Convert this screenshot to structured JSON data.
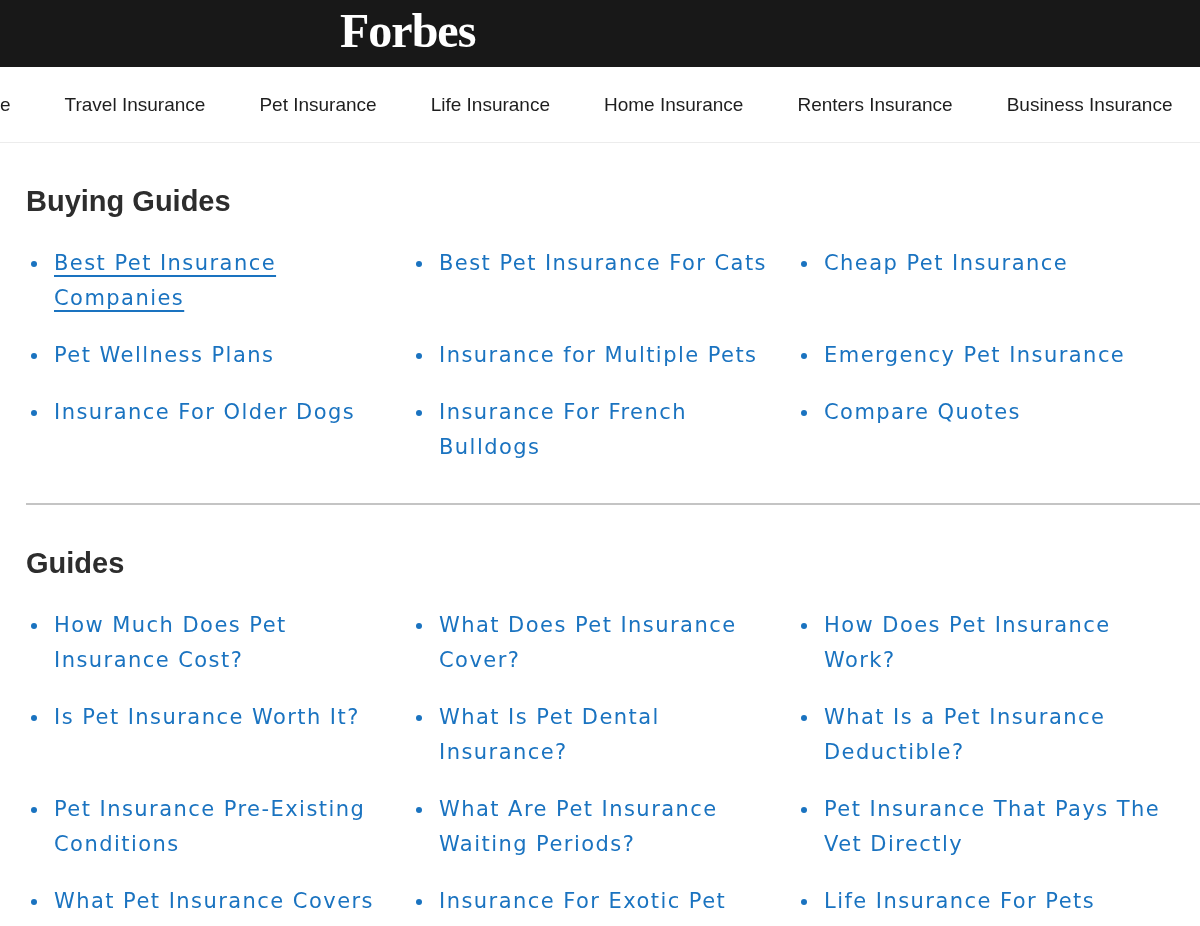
{
  "header": {
    "logo": "Forbes"
  },
  "nav": {
    "items": [
      {
        "label": "e"
      },
      {
        "label": "Travel Insurance"
      },
      {
        "label": "Pet Insurance"
      },
      {
        "label": "Life Insurance"
      },
      {
        "label": "Home Insurance"
      },
      {
        "label": "Renters Insurance"
      },
      {
        "label": "Business Insurance"
      }
    ]
  },
  "sections": [
    {
      "title": "Buying Guides",
      "links": [
        {
          "text": "Best Pet Insurance Companies",
          "hovered": true
        },
        {
          "text": "Best Pet Insurance For Cats",
          "hovered": false
        },
        {
          "text": "Cheap Pet Insurance",
          "hovered": false
        },
        {
          "text": "Pet Wellness Plans",
          "hovered": false
        },
        {
          "text": "Insurance for Multiple Pets",
          "hovered": false
        },
        {
          "text": "Emergency Pet Insurance",
          "hovered": false
        },
        {
          "text": "Insurance For Older Dogs",
          "hovered": false
        },
        {
          "text": "Insurance For French Bulldogs",
          "hovered": false
        },
        {
          "text": "Compare Quotes",
          "hovered": false
        }
      ]
    },
    {
      "title": "Guides",
      "links": [
        {
          "text": "How Much Does Pet Insurance Cost?",
          "hovered": false
        },
        {
          "text": "What Does Pet Insurance Cover?",
          "hovered": false
        },
        {
          "text": "How Does Pet Insurance Work?",
          "hovered": false
        },
        {
          "text": "Is Pet Insurance Worth It?",
          "hovered": false
        },
        {
          "text": "What Is Pet Dental Insurance?",
          "hovered": false
        },
        {
          "text": "What Is a Pet Insurance Deductible?",
          "hovered": false
        },
        {
          "text": "Pet Insurance Pre-Existing Conditions",
          "hovered": false
        },
        {
          "text": "What Are Pet Insurance Waiting Periods?",
          "hovered": false
        },
        {
          "text": "Pet Insurance That Pays The Vet Directly",
          "hovered": false
        },
        {
          "text": "What Pet Insurance Covers",
          "hovered": false
        },
        {
          "text": "Insurance For Exotic Pet",
          "hovered": false
        },
        {
          "text": "Life Insurance For Pets",
          "hovered": false
        }
      ]
    }
  ]
}
